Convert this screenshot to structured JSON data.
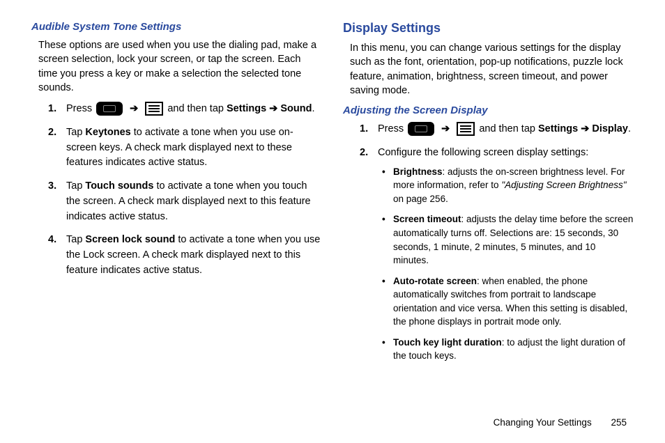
{
  "left": {
    "h_audible": "Audible System Tone Settings",
    "intro": "These options are used when you use the dialing pad, make a screen selection, lock your screen, or tap the screen. Each time you press a key or make a selection the selected tone sounds.",
    "step1_a": "Press ",
    "step1_b": " and then tap ",
    "step1_settings": "Settings",
    "step1_sound": "Sound",
    "step2_a": "Tap ",
    "step2_keytones": "Keytones",
    "step2_b": " to activate a tone when you use on-screen keys. A check mark displayed next to these features indicates active status.",
    "step3_a": "Tap ",
    "step3_touch": "Touch sounds",
    "step3_b": " to activate a tone when you touch the screen. A check mark displayed next to this feature indicates active status.",
    "step4_a": "Tap ",
    "step4_lock": "Screen lock sound",
    "step4_b": " to activate a tone when you use the Lock screen. A check mark displayed next to this feature indicates active status."
  },
  "right": {
    "h_display": "Display Settings",
    "intro": "In this menu, you can change various settings for the display such as the font, orientation, pop-up notifications, puzzle lock feature, animation, brightness, screen timeout, and power saving mode.",
    "h_adjusting": "Adjusting the Screen Display",
    "step1_a": "Press ",
    "step1_b": " and then tap ",
    "step1_settings": "Settings",
    "step1_display": "Display",
    "step2": "Configure the following screen display settings:",
    "b1_label": "Brightness",
    "b1_text": ": adjusts the on-screen brightness level. For more information, refer to ",
    "b1_ref": "\"Adjusting Screen Brightness\"",
    "b1_tail": "  on page 256.",
    "b2_label": "Screen timeout",
    "b2_text": ": adjusts the delay time before the screen automatically turns off. Selections are: 15 seconds, 30 seconds, 1 minute, 2 minutes, 5 minutes, and 10 minutes.",
    "b3_label": "Auto-rotate screen",
    "b3_text": ": when enabled, the phone automatically switches from portrait to landscape orientation and vice versa. When this setting is disabled, the phone displays in portrait mode only.",
    "b4_label": "Touch key light duration",
    "b4_text": ": to adjust the light duration of the touch keys."
  },
  "footer": {
    "section": "Changing Your Settings",
    "page": "255"
  },
  "arrow": "➔",
  "period": "."
}
